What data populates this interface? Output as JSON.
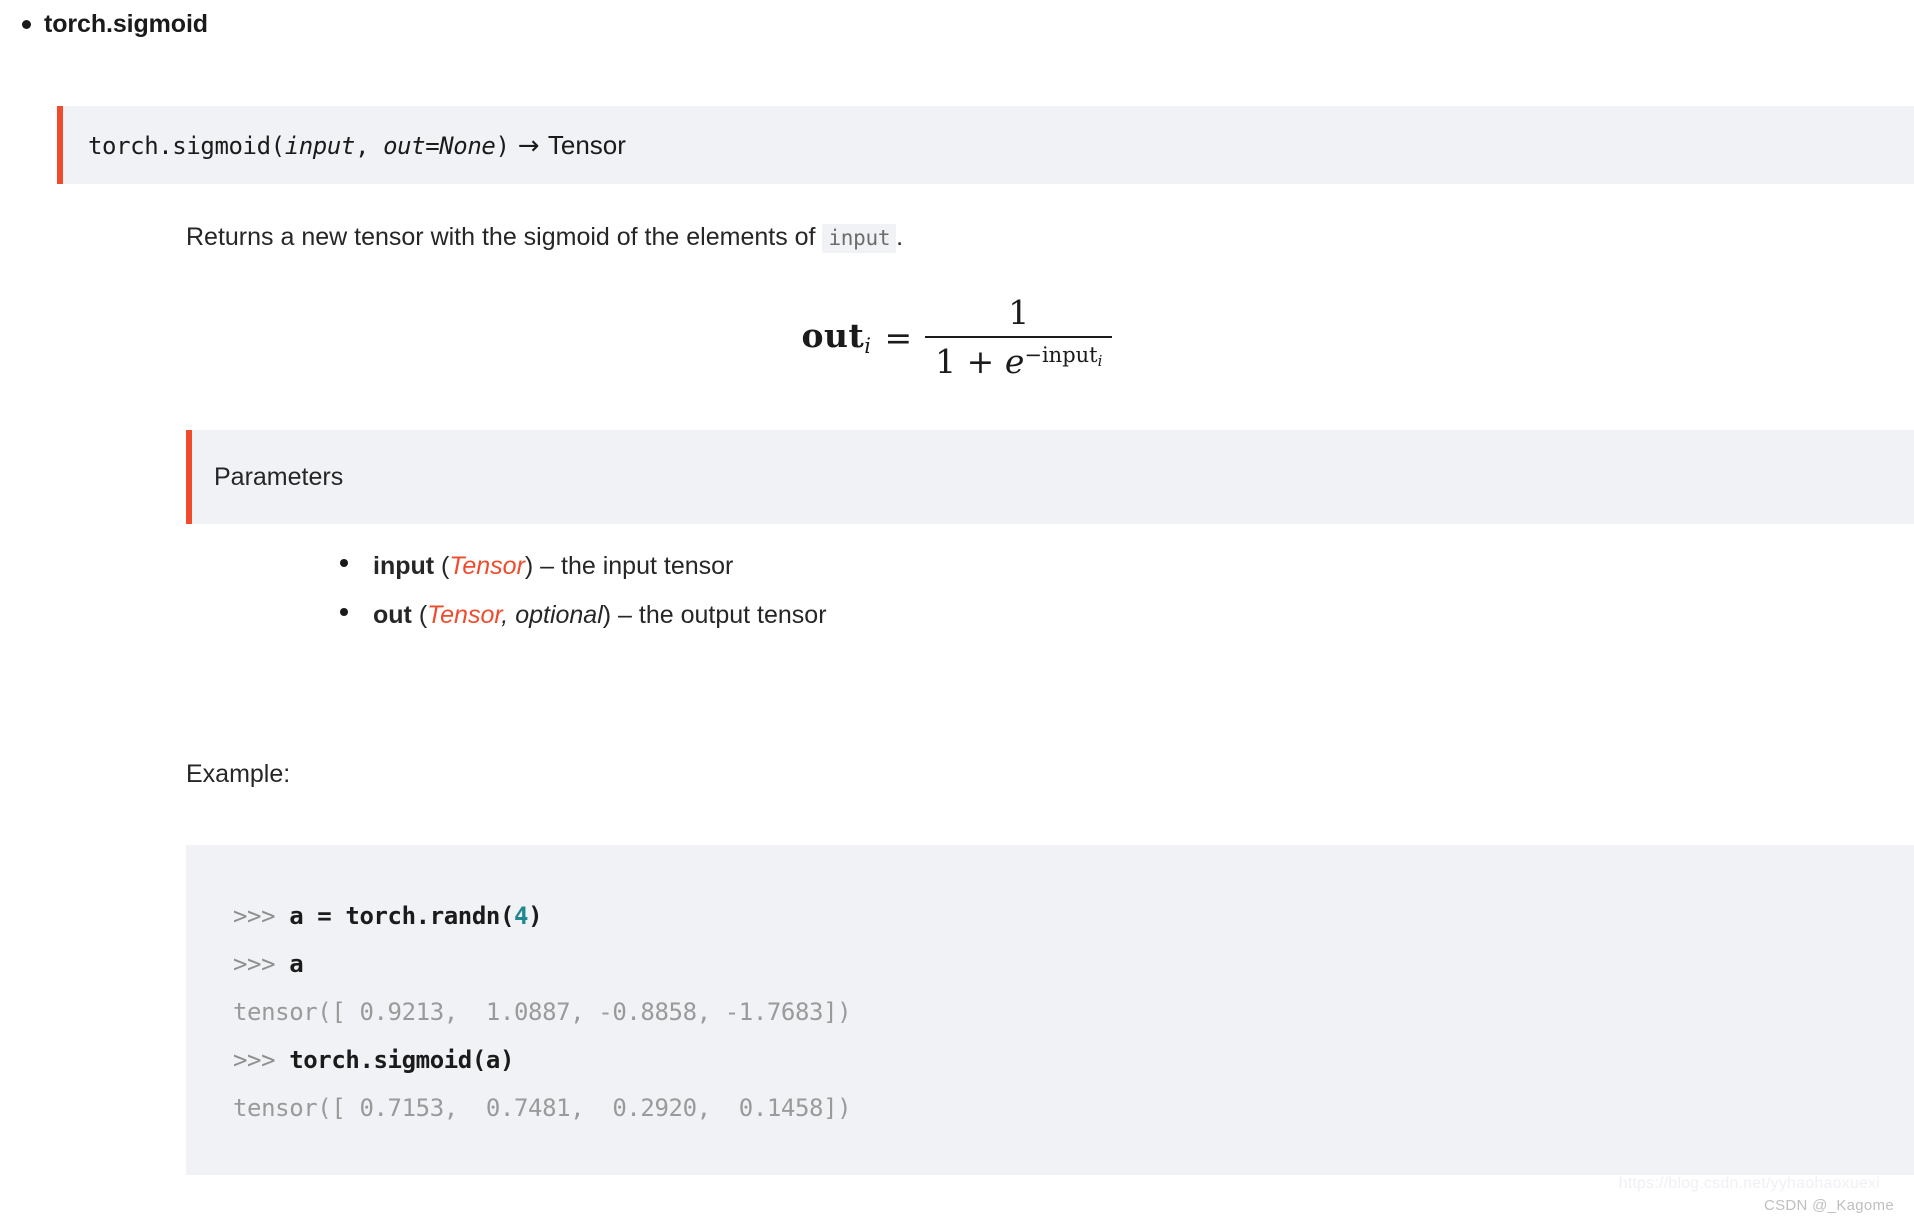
{
  "heading": {
    "bullet_label": "torch.sigmoid"
  },
  "signature": {
    "func": "torch.sigmoid(",
    "arg1": "input",
    "comma": ", ",
    "arg2": "out=None",
    "close": ")",
    "arrow": " → ",
    "return_type": "Tensor"
  },
  "description": {
    "before": "Returns a new tensor with the sigmoid of the elements of ",
    "code": "input",
    "after": "."
  },
  "formula": {
    "lhs": "out",
    "lhs_sub": "i",
    "equals": "=",
    "numerator": "1",
    "den_one": "1",
    "den_plus": "+",
    "den_e": "e",
    "den_exp_minus": "−",
    "den_exp": "input",
    "den_exp_sub": "i",
    "plain": "out_i = 1 / (1 + e^(-input_i))"
  },
  "parameters": {
    "title": "Parameters",
    "items": [
      {
        "name": "input",
        "open": " (",
        "type": "Tensor",
        "optional": "",
        "close": ")",
        "dash": " – ",
        "desc": "the input tensor"
      },
      {
        "name": "out",
        "open": " (",
        "type": "Tensor",
        "optional": ", optional",
        "close": ")",
        "dash": " – ",
        "desc": "the output tensor"
      }
    ]
  },
  "example": {
    "label": "Example:",
    "lines": [
      {
        "kind": "input",
        "prompt": ">>> ",
        "code": "a = torch.randn(",
        "num": "4",
        "tail": ")"
      },
      {
        "kind": "input",
        "prompt": ">>> ",
        "code": "a",
        "num": "",
        "tail": ""
      },
      {
        "kind": "output",
        "text": "tensor([ 0.9213,  1.0887, -0.8858, -1.7683])"
      },
      {
        "kind": "input",
        "prompt": ">>> ",
        "code": "torch.sigmoid(a)",
        "num": "",
        "tail": ""
      },
      {
        "kind": "output",
        "text": "tensor([ 0.7153,  0.7481,  0.2920,  0.1458])"
      }
    ]
  },
  "watermark": {
    "url": "https://blog.csdn.net/yyhaohaoxuexi",
    "user": "CSDN @_Kagome"
  },
  "colors": {
    "accent": "#ee4c2c",
    "panel_bg": "#f0f2f5",
    "text": "#262626",
    "code_number": "#20898f",
    "code_output": "#9a9a9a"
  }
}
